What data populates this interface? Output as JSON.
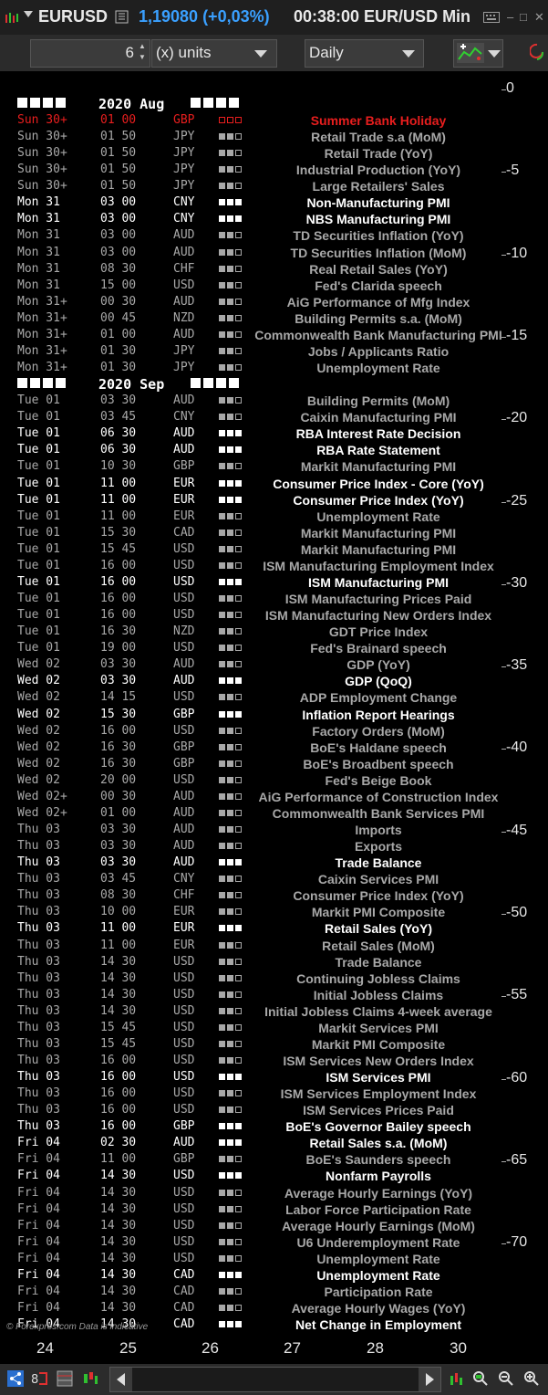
{
  "titlebar": {
    "symbol": "EURUSD",
    "price": "1,19080 (+0,03%)",
    "time_label": "00:38:00 EUR/USD Min",
    "window_controls": [
      "keyboard-icon",
      "minimize-icon",
      "maximize-icon",
      "close-icon"
    ]
  },
  "toolbar": {
    "units_value": "6",
    "units_label": "(x) units",
    "period_label": "Daily"
  },
  "calendar": {
    "months": {
      "aug": "2020 Aug",
      "sep": "2020 Sep"
    },
    "colors": {
      "holiday": "#e81e1e",
      "high": "#ffffff",
      "dim": "#a8a8a8"
    },
    "events": [
      {
        "day": "Sun 30+",
        "time": "01 00",
        "cur": "GBP",
        "imp": "holiday",
        "name": "Summer Bank Holiday"
      },
      {
        "day": "Sun 30+",
        "time": "01 50",
        "cur": "JPY",
        "imp": "medium",
        "name": "Retail Trade s.a (MoM)"
      },
      {
        "day": "Sun 30+",
        "time": "01 50",
        "cur": "JPY",
        "imp": "medium",
        "name": "Retail Trade (YoY)"
      },
      {
        "day": "Sun 30+",
        "time": "01 50",
        "cur": "JPY",
        "imp": "medium",
        "name": "Industrial Production (YoY)"
      },
      {
        "day": "Sun 30+",
        "time": "01 50",
        "cur": "JPY",
        "imp": "medium",
        "name": "Large Retailers' Sales"
      },
      {
        "day": "Mon 31",
        "time": "03 00",
        "cur": "CNY",
        "imp": "high",
        "name": "Non-Manufacturing PMI"
      },
      {
        "day": "Mon 31",
        "time": "03 00",
        "cur": "CNY",
        "imp": "high",
        "name": "NBS Manufacturing PMI"
      },
      {
        "day": "Mon 31",
        "time": "03 00",
        "cur": "AUD",
        "imp": "medium",
        "name": "TD Securities Inflation (YoY)"
      },
      {
        "day": "Mon 31",
        "time": "03 00",
        "cur": "AUD",
        "imp": "medium",
        "name": "TD Securities Inflation (MoM)"
      },
      {
        "day": "Mon 31",
        "time": "08 30",
        "cur": "CHF",
        "imp": "medium",
        "name": "Real Retail Sales (YoY)"
      },
      {
        "day": "Mon 31",
        "time": "15 00",
        "cur": "USD",
        "imp": "medium",
        "name": "Fed's Clarida speech"
      },
      {
        "day": "Mon 31+",
        "time": "00 30",
        "cur": "AUD",
        "imp": "medium",
        "name": "AiG Performance of Mfg Index"
      },
      {
        "day": "Mon 31+",
        "time": "00 45",
        "cur": "NZD",
        "imp": "medium",
        "name": "Building Permits s.a. (MoM)"
      },
      {
        "day": "Mon 31+",
        "time": "01 00",
        "cur": "AUD",
        "imp": "medium",
        "name": "Commonwealth Bank Manufacturing PMI"
      },
      {
        "day": "Mon 31+",
        "time": "01 30",
        "cur": "JPY",
        "imp": "medium",
        "name": "Jobs / Applicants Ratio"
      },
      {
        "day": "Mon 31+",
        "time": "01 30",
        "cur": "JPY",
        "imp": "medium",
        "name": "Unemployment Rate"
      },
      {
        "month": "sep"
      },
      {
        "day": "Tue 01",
        "time": "03 30",
        "cur": "AUD",
        "imp": "medium",
        "name": "Building Permits (MoM)"
      },
      {
        "day": "Tue 01",
        "time": "03 45",
        "cur": "CNY",
        "imp": "medium",
        "name": "Caixin Manufacturing PMI"
      },
      {
        "day": "Tue 01",
        "time": "06 30",
        "cur": "AUD",
        "imp": "high",
        "name": "RBA Interest Rate Decision"
      },
      {
        "day": "Tue 01",
        "time": "06 30",
        "cur": "AUD",
        "imp": "high",
        "name": "RBA Rate Statement"
      },
      {
        "day": "Tue 01",
        "time": "10 30",
        "cur": "GBP",
        "imp": "medium",
        "name": "Markit Manufacturing PMI"
      },
      {
        "day": "Tue 01",
        "time": "11 00",
        "cur": "EUR",
        "imp": "high",
        "name": "Consumer Price Index - Core (YoY)"
      },
      {
        "day": "Tue 01",
        "time": "11 00",
        "cur": "EUR",
        "imp": "high",
        "name": "Consumer Price Index (YoY)"
      },
      {
        "day": "Tue 01",
        "time": "11 00",
        "cur": "EUR",
        "imp": "medium",
        "name": "Unemployment Rate"
      },
      {
        "day": "Tue 01",
        "time": "15 30",
        "cur": "CAD",
        "imp": "medium",
        "name": "Markit Manufacturing PMI"
      },
      {
        "day": "Tue 01",
        "time": "15 45",
        "cur": "USD",
        "imp": "medium",
        "name": "Markit Manufacturing PMI"
      },
      {
        "day": "Tue 01",
        "time": "16 00",
        "cur": "USD",
        "imp": "medium",
        "name": "ISM Manufacturing Employment Index"
      },
      {
        "day": "Tue 01",
        "time": "16 00",
        "cur": "USD",
        "imp": "high",
        "name": "ISM Manufacturing PMI"
      },
      {
        "day": "Tue 01",
        "time": "16 00",
        "cur": "USD",
        "imp": "medium",
        "name": "ISM Manufacturing Prices Paid"
      },
      {
        "day": "Tue 01",
        "time": "16 00",
        "cur": "USD",
        "imp": "medium",
        "name": "ISM Manufacturing New Orders Index"
      },
      {
        "day": "Tue 01",
        "time": "16 30",
        "cur": "NZD",
        "imp": "medium",
        "name": "GDT Price Index"
      },
      {
        "day": "Tue 01",
        "time": "19 00",
        "cur": "USD",
        "imp": "medium",
        "name": "Fed's Brainard speech"
      },
      {
        "day": "Wed 02",
        "time": "03 30",
        "cur": "AUD",
        "imp": "medium",
        "name": "GDP (YoY)"
      },
      {
        "day": "Wed 02",
        "time": "03 30",
        "cur": "AUD",
        "imp": "high",
        "name": "GDP (QoQ)"
      },
      {
        "day": "Wed 02",
        "time": "14 15",
        "cur": "USD",
        "imp": "medium",
        "name": "ADP Employment Change"
      },
      {
        "day": "Wed 02",
        "time": "15 30",
        "cur": "GBP",
        "imp": "high",
        "name": "Inflation Report Hearings"
      },
      {
        "day": "Wed 02",
        "time": "16 00",
        "cur": "USD",
        "imp": "medium",
        "name": "Factory Orders (MoM)"
      },
      {
        "day": "Wed 02",
        "time": "16 30",
        "cur": "GBP",
        "imp": "medium",
        "name": "BoE's Haldane speech"
      },
      {
        "day": "Wed 02",
        "time": "16 30",
        "cur": "GBP",
        "imp": "medium",
        "name": "BoE's Broadbent speech"
      },
      {
        "day": "Wed 02",
        "time": "20 00",
        "cur": "USD",
        "imp": "medium",
        "name": "Fed's Beige Book"
      },
      {
        "day": "Wed 02+",
        "time": "00 30",
        "cur": "AUD",
        "imp": "medium",
        "name": "AiG Performance of Construction Index"
      },
      {
        "day": "Wed 02+",
        "time": "01 00",
        "cur": "AUD",
        "imp": "medium",
        "name": "Commonwealth Bank Services PMI"
      },
      {
        "day": "Thu 03",
        "time": "03 30",
        "cur": "AUD",
        "imp": "medium",
        "name": "Imports"
      },
      {
        "day": "Thu 03",
        "time": "03 30",
        "cur": "AUD",
        "imp": "medium",
        "name": "Exports"
      },
      {
        "day": "Thu 03",
        "time": "03 30",
        "cur": "AUD",
        "imp": "high",
        "name": "Trade Balance"
      },
      {
        "day": "Thu 03",
        "time": "03 45",
        "cur": "CNY",
        "imp": "medium",
        "name": "Caixin Services PMI"
      },
      {
        "day": "Thu 03",
        "time": "08 30",
        "cur": "CHF",
        "imp": "medium",
        "name": "Consumer Price Index (YoY)"
      },
      {
        "day": "Thu 03",
        "time": "10 00",
        "cur": "EUR",
        "imp": "medium",
        "name": "Markit PMI Composite"
      },
      {
        "day": "Thu 03",
        "time": "11 00",
        "cur": "EUR",
        "imp": "high",
        "name": "Retail Sales (YoY)"
      },
      {
        "day": "Thu 03",
        "time": "11 00",
        "cur": "EUR",
        "imp": "medium",
        "name": "Retail Sales (MoM)"
      },
      {
        "day": "Thu 03",
        "time": "14 30",
        "cur": "USD",
        "imp": "medium",
        "name": "Trade Balance"
      },
      {
        "day": "Thu 03",
        "time": "14 30",
        "cur": "USD",
        "imp": "medium",
        "name": "Continuing Jobless Claims"
      },
      {
        "day": "Thu 03",
        "time": "14 30",
        "cur": "USD",
        "imp": "medium",
        "name": "Initial Jobless Claims"
      },
      {
        "day": "Thu 03",
        "time": "14 30",
        "cur": "USD",
        "imp": "medium",
        "name": "Initial Jobless Claims 4-week average"
      },
      {
        "day": "Thu 03",
        "time": "15 45",
        "cur": "USD",
        "imp": "medium",
        "name": "Markit Services PMI"
      },
      {
        "day": "Thu 03",
        "time": "15 45",
        "cur": "USD",
        "imp": "medium",
        "name": "Markit PMI Composite"
      },
      {
        "day": "Thu 03",
        "time": "16 00",
        "cur": "USD",
        "imp": "medium",
        "name": "ISM Services New Orders Index"
      },
      {
        "day": "Thu 03",
        "time": "16 00",
        "cur": "USD",
        "imp": "high",
        "name": "ISM Services PMI"
      },
      {
        "day": "Thu 03",
        "time": "16 00",
        "cur": "USD",
        "imp": "medium",
        "name": "ISM Services Employment Index"
      },
      {
        "day": "Thu 03",
        "time": "16 00",
        "cur": "USD",
        "imp": "medium",
        "name": "ISM Services Prices Paid"
      },
      {
        "day": "Thu 03",
        "time": "16 00",
        "cur": "GBP",
        "imp": "high",
        "name": "BoE's Governor Bailey speech"
      },
      {
        "day": "Fri 04",
        "time": "02 30",
        "cur": "AUD",
        "imp": "high",
        "name": "Retail Sales s.a. (MoM)"
      },
      {
        "day": "Fri 04",
        "time": "11 00",
        "cur": "GBP",
        "imp": "medium",
        "name": "BoE's Saunders speech"
      },
      {
        "day": "Fri 04",
        "time": "14 30",
        "cur": "USD",
        "imp": "high",
        "name": "Nonfarm Payrolls"
      },
      {
        "day": "Fri 04",
        "time": "14 30",
        "cur": "USD",
        "imp": "medium",
        "name": "Average Hourly Earnings (YoY)"
      },
      {
        "day": "Fri 04",
        "time": "14 30",
        "cur": "USD",
        "imp": "medium",
        "name": "Labor Force Participation Rate"
      },
      {
        "day": "Fri 04",
        "time": "14 30",
        "cur": "USD",
        "imp": "medium",
        "name": "Average Hourly Earnings (MoM)"
      },
      {
        "day": "Fri 04",
        "time": "14 30",
        "cur": "USD",
        "imp": "medium",
        "name": "U6 Underemployment Rate"
      },
      {
        "day": "Fri 04",
        "time": "14 30",
        "cur": "USD",
        "imp": "medium",
        "name": "Unemployment Rate"
      },
      {
        "day": "Fri 04",
        "time": "14 30",
        "cur": "CAD",
        "imp": "high",
        "name": "Unemployment Rate"
      },
      {
        "day": "Fri 04",
        "time": "14 30",
        "cur": "CAD",
        "imp": "medium",
        "name": "Participation Rate"
      },
      {
        "day": "Fri 04",
        "time": "14 30",
        "cur": "CAD",
        "imp": "medium",
        "name": "Average Hourly Wages (YoY)"
      },
      {
        "day": "Fri 04",
        "time": "14 30",
        "cur": "CAD",
        "imp": "high",
        "name": "Net Change in Employment"
      }
    ],
    "watermark": "© Forexpros.com  Data is indicative"
  },
  "yaxis": {
    "ticks": [
      "0",
      "-5",
      "-10",
      "-15",
      "-20",
      "-25",
      "-30",
      "-35",
      "-40",
      "-45",
      "-50",
      "-55",
      "-60",
      "-65",
      "-70"
    ]
  },
  "xaxis": {
    "ticks": [
      "24",
      "25",
      "26",
      "27",
      "28",
      "30"
    ]
  }
}
